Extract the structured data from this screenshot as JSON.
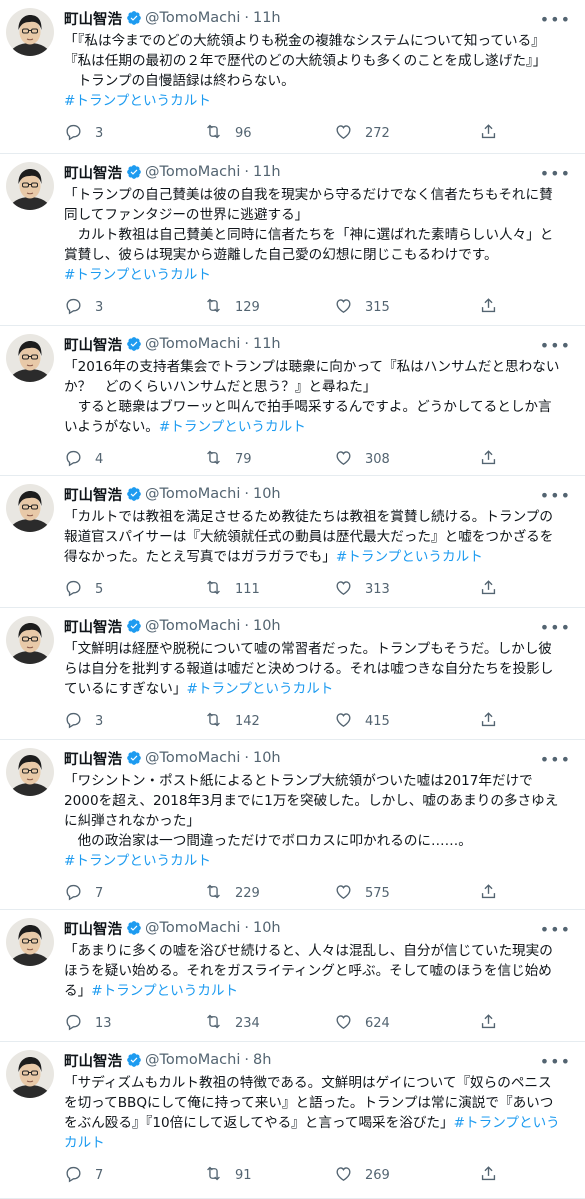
{
  "tweets": [
    {
      "name": "町山智浩",
      "handle": "@TomoMachi",
      "time": "11h",
      "lines": [
        "「『私は今までのどの大統領よりも税金の複雑なシステムについて知っている』",
        "『私は任期の最初の２年で歴代のどの大統領よりも多くのことを成し遂げた』」",
        "　トランプの自慢語録は終わらない。"
      ],
      "hashtag": "#トランプというカルト",
      "hashtag_inline": false,
      "replies": "3",
      "retweets": "96",
      "likes": "272",
      "height": 154
    },
    {
      "name": "町山智浩",
      "handle": "@TomoMachi",
      "time": "11h",
      "lines": [
        "「トランプの自己賛美は彼の自我を現実から守るだけでなく信者たちもそれに賛",
        "同してファンタジーの世界に逃避する」",
        "　カルト教祖は自己賛美と同時に信者たちを「神に選ばれた素晴らしい人々」と",
        "賞賛し、彼らは現実から遊離した自己愛の幻想に閉じこもるわけです。"
      ],
      "hashtag": "#トランプというカルト",
      "hashtag_inline": false,
      "replies": "3",
      "retweets": "129",
      "likes": "315",
      "height": 172
    },
    {
      "name": "町山智浩",
      "handle": "@TomoMachi",
      "time": "11h",
      "lines": [
        "「2016年の支持者集会でトランプは聴衆に向かって『私はハンサムだと思わない",
        "か？　どのくらいハンサムだと思う？』と尋ねた」",
        "　すると聴衆はブワーッと叫んで拍手喝采するんですよ。どうかしてるとしか言",
        "いようがない。"
      ],
      "hashtag": "#トランプというカルト",
      "hashtag_inline": true,
      "replies": "4",
      "retweets": "79",
      "likes": "308",
      "height": 150
    },
    {
      "name": "町山智浩",
      "handle": "@TomoMachi",
      "time": "10h",
      "lines": [
        "「カルトでは教祖を満足させるため教徒たちは教祖を賞賛し続ける。トランプの",
        "報道官スパイサーは『大統領就任式の動員は歴代最大だった』と嘘をつかざるを",
        "得なかった。たとえ写真ではガラガラでも」"
      ],
      "hashtag": "#トランプというカルト",
      "hashtag_inline": true,
      "replies": "5",
      "retweets": "111",
      "likes": "313",
      "height": 132
    },
    {
      "name": "町山智浩",
      "handle": "@TomoMachi",
      "time": "10h",
      "lines": [
        "「文鮮明は経歴や脱税について嘘の常習者だった。トランプもそうだ。しかし彼",
        "らは自分を批判する報道は嘘だと決めつける。それは嘘つきな自分たちを投影し",
        "ているにすぎない」"
      ],
      "hashtag": "#トランプというカルト",
      "hashtag_inline": true,
      "replies": "3",
      "retweets": "142",
      "likes": "415",
      "height": 132
    },
    {
      "name": "町山智浩",
      "handle": "@TomoMachi",
      "time": "10h",
      "lines": [
        "「ワシントン・ポスト紙によるとトランプ大統領がついた嘘は2017年だけで",
        "2000を超え、2018年3月までに1万を突破した。しかし、嘘のあまりの多さゆえ",
        "に糾弾されなかった」",
        "　他の政治家は一つ間違っただけでボロカスに叩かれるのに……。"
      ],
      "hashtag": "#トランプというカルト",
      "hashtag_inline": false,
      "replies": "7",
      "retweets": "229",
      "likes": "575",
      "height": 170
    },
    {
      "name": "町山智浩",
      "handle": "@TomoMachi",
      "time": "10h",
      "lines": [
        "「あまりに多くの嘘を浴びせ続けると、人々は混乱し、自分が信じていた現実の",
        "ほうを疑い始める。それをガスライティングと呼ぶ。そして嘘のほうを信じ始め",
        "る」"
      ],
      "hashtag": "#トランプというカルト",
      "hashtag_inline": true,
      "replies": "13",
      "retweets": "234",
      "likes": "624",
      "height": 132
    },
    {
      "name": "町山智浩",
      "handle": "@TomoMachi",
      "time": "8h",
      "lines": [
        "「サディズムもカルト教祖の特徴である。文鮮明はゲイについて『奴らのペニス",
        "を切ってBBQにして俺に持って来い』と語った。トランプは常に演説で『あいつ",
        "をぶん殴る』『10倍にして返してやる』と言って喝采を浴びた」"
      ],
      "hashtag": "#トランプという",
      "hashtag_inline": true,
      "hashtag_tail": "カルト",
      "replies": "7",
      "retweets": "91",
      "likes": "269",
      "height": 157
    }
  ],
  "colors": {
    "hashtag": "#1d9bf0",
    "verified": "#1d9bf0",
    "muted": "#536471"
  },
  "icons": {
    "reply": "reply-icon",
    "retweet": "retweet-icon",
    "like": "heart-icon",
    "share": "share-icon",
    "more": "more-icon",
    "verified": "verified-badge-icon"
  }
}
